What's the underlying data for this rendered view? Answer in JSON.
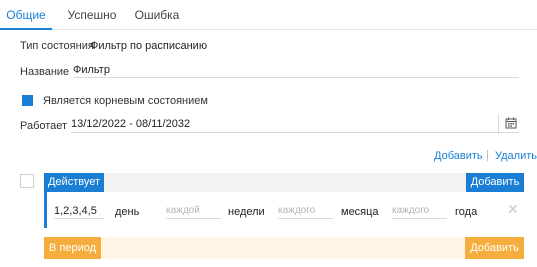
{
  "tabs": [
    {
      "label": "Общие",
      "active": true
    },
    {
      "label": "Успешно",
      "active": false
    },
    {
      "label": "Ошибка",
      "active": false
    }
  ],
  "state_type": {
    "label": "Тип состояния",
    "value": "Фильтр по расписанию"
  },
  "name": {
    "label": "Название",
    "value": "Фильтр"
  },
  "root_state": {
    "label": "Является корневым состоянием",
    "checked": true
  },
  "works": {
    "label": "Работает",
    "value": "13/12/2022 - 08/11/2032"
  },
  "actions": {
    "add": "Добавить",
    "delete": "Удалить"
  },
  "active_section": {
    "tag": "Действует",
    "add": "Добавить"
  },
  "rule": {
    "days_value": "1,2,3,4,5",
    "day_unit": "день",
    "week_placeholder": "каждой",
    "week_unit": "недели",
    "month_placeholder": "каждого",
    "month_unit": "месяца",
    "year_placeholder": "каждого",
    "year_unit": "года"
  },
  "period_section": {
    "tag": "В период",
    "add": "Добавить"
  },
  "colors": {
    "accent": "#1a7fd4",
    "warning": "#f5ae3d",
    "warning_bg": "#fff5e6"
  },
  "icons": {
    "calendar": "calendar-icon",
    "close": "close-icon"
  }
}
